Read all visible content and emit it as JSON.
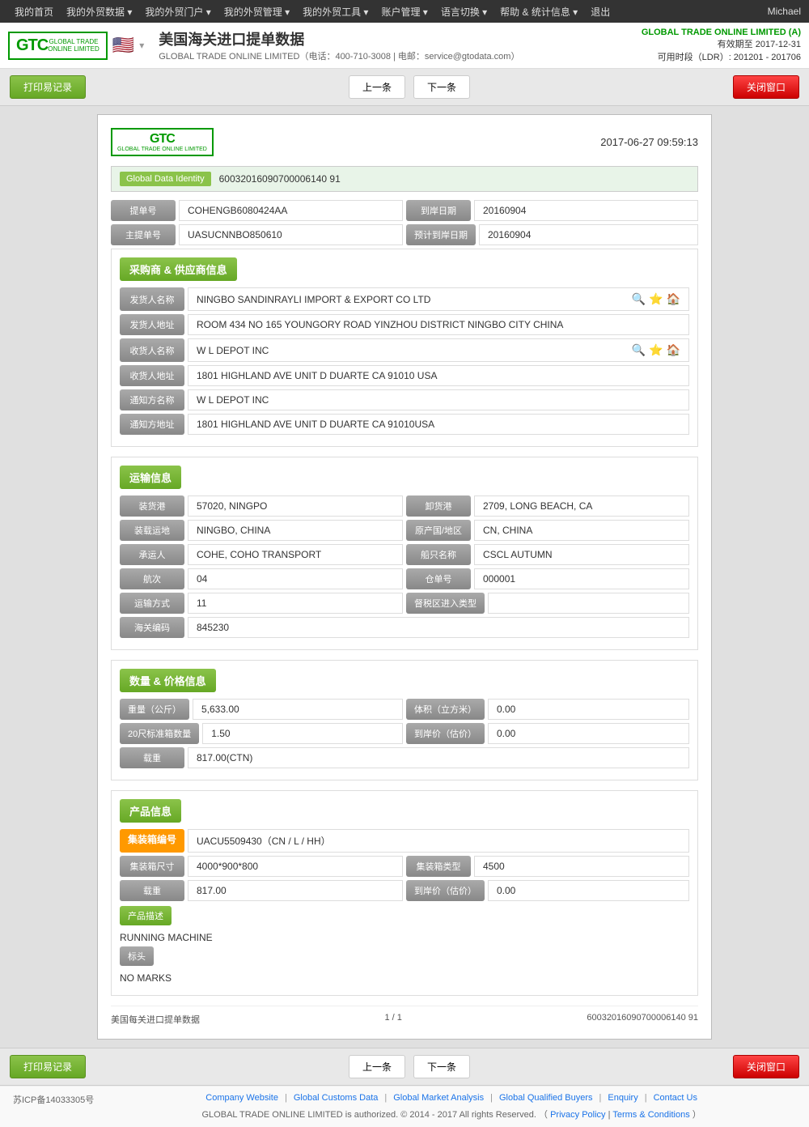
{
  "topnav": {
    "items": [
      "我的首页",
      "我的外贸数据",
      "我的外贸门户",
      "我的外贸管理",
      "我的外贸工具",
      "账户管理",
      "语言切换",
      "帮助&统计信息",
      "退出"
    ],
    "user": "Michael"
  },
  "header": {
    "title": "美国海关进口提单数据",
    "company_line": "GLOBAL TRADE ONLINE LIMITED（电话：400-710-3008 | 电邮：service@gtodata.com）",
    "account_company": "GLOBAL TRADE ONLINE LIMITED (A)",
    "validity": "有效期至 2017-12-31",
    "ldr": "可用时段（LDR）: 201201 - 201706"
  },
  "toolbar": {
    "print_btn": "打印易记录",
    "prev_btn": "上一条",
    "next_btn": "下一条",
    "close_btn": "关闭窗口"
  },
  "record": {
    "date": "2017-06-27  09:59:13",
    "identity_label": "Global Data Identity",
    "identity_value": "60032016090700006140 91",
    "bill_label": "提单号",
    "bill_value": "COHENGB6080424AA",
    "arrival_date_label": "到岸日期",
    "arrival_date_value": "20160904",
    "master_bill_label": "主提单号",
    "master_bill_value": "UASUCNNBO850610",
    "expected_arrival_label": "预计到岸日期",
    "expected_arrival_value": "20160904"
  },
  "buyer_supplier": {
    "section_label": "采购商 & 供应商信息",
    "shipper_name_label": "发货人名称",
    "shipper_name_value": "NINGBO SANDINRAYLI IMPORT & EXPORT CO LTD",
    "shipper_addr_label": "发货人地址",
    "shipper_addr_value": "ROOM 434 NO 165 YOUNGORY ROAD YINZHOU DISTRICT NINGBO CITY CHINA",
    "consignee_name_label": "收货人名称",
    "consignee_name_value": "W L DEPOT INC",
    "consignee_addr_label": "收货人地址",
    "consignee_addr_value": "1801 HIGHLAND AVE UNIT D DUARTE CA 91010 USA",
    "notify_name_label": "通知方名称",
    "notify_name_value": "W L DEPOT INC",
    "notify_addr_label": "通知方地址",
    "notify_addr_value": "1801 HIGHLAND AVE UNIT D DUARTE CA 91010USA"
  },
  "transport": {
    "section_label": "运输信息",
    "loading_port_label": "装货港",
    "loading_port_value": "57020, NINGPO",
    "unloading_port_label": "卸货港",
    "unloading_port_value": "2709, LONG BEACH, CA",
    "loading_place_label": "装载运地",
    "loading_place_value": "NINGBO, CHINA",
    "origin_country_label": "原产国/地区",
    "origin_country_value": "CN, CHINA",
    "carrier_label": "承运人",
    "carrier_value": "COHE, COHO TRANSPORT",
    "vessel_label": "船只名称",
    "vessel_value": "CSCL AUTUMN",
    "voyage_label": "航次",
    "voyage_value": "04",
    "bill_of_lading_label": "仓单号",
    "bill_of_lading_value": "000001",
    "transport_mode_label": "运输方式",
    "transport_mode_value": "11",
    "ftz_type_label": "督税区进入类型",
    "ftz_type_value": "",
    "customs_code_label": "海关编码",
    "customs_code_value": "845230"
  },
  "quantity_price": {
    "section_label": "数量 & 价格信息",
    "weight_label": "重量（公斤）",
    "weight_value": "5,633.00",
    "volume_label": "体积（立方米）",
    "volume_value": "0.00",
    "container_20_label": "20尺标准箱数量",
    "container_20_value": "1.50",
    "arrival_price_label": "到岸价（估价）",
    "arrival_price_value": "0.00",
    "quantity_label": "载重",
    "quantity_value": "817.00(CTN)"
  },
  "product": {
    "section_label": "产品信息",
    "container_no_label": "集装箱编号",
    "container_no_value": "UACU5509430（CN / L / HH）",
    "container_size_label": "集装箱尺寸",
    "container_size_value": "4000*900*800",
    "container_type_label": "集装箱类型",
    "container_type_value": "4500",
    "quantity_label": "载重",
    "quantity_value": "817.00",
    "arrival_price_label": "到岸价（估价）",
    "arrival_price_value": "0.00",
    "desc_label": "产品描述",
    "desc_value": "RUNNING MACHINE",
    "marks_label": "标头",
    "marks_value": "NO MARKS"
  },
  "bottom_bar": {
    "print_btn": "打印易记录",
    "prev_btn": "上一条",
    "next_btn": "下一条",
    "close_btn": "关闭窗口",
    "data_source": "美国每关进口提单数据",
    "page_info": "1 / 1",
    "record_id": "60032016090700006140 91"
  },
  "footer": {
    "icp": "苏ICP备14033305号",
    "links": [
      "Company Website",
      "Global Customs Data",
      "Global Market Analysis",
      "Global Qualified Buyers",
      "Enquiry",
      "Contact Us"
    ],
    "copyright": "GLOBAL TRADE ONLINE LIMITED is authorized. © 2014 - 2017 All rights Reserved.",
    "privacy": "Privacy Policy",
    "terms": "Terms & Conditions"
  }
}
